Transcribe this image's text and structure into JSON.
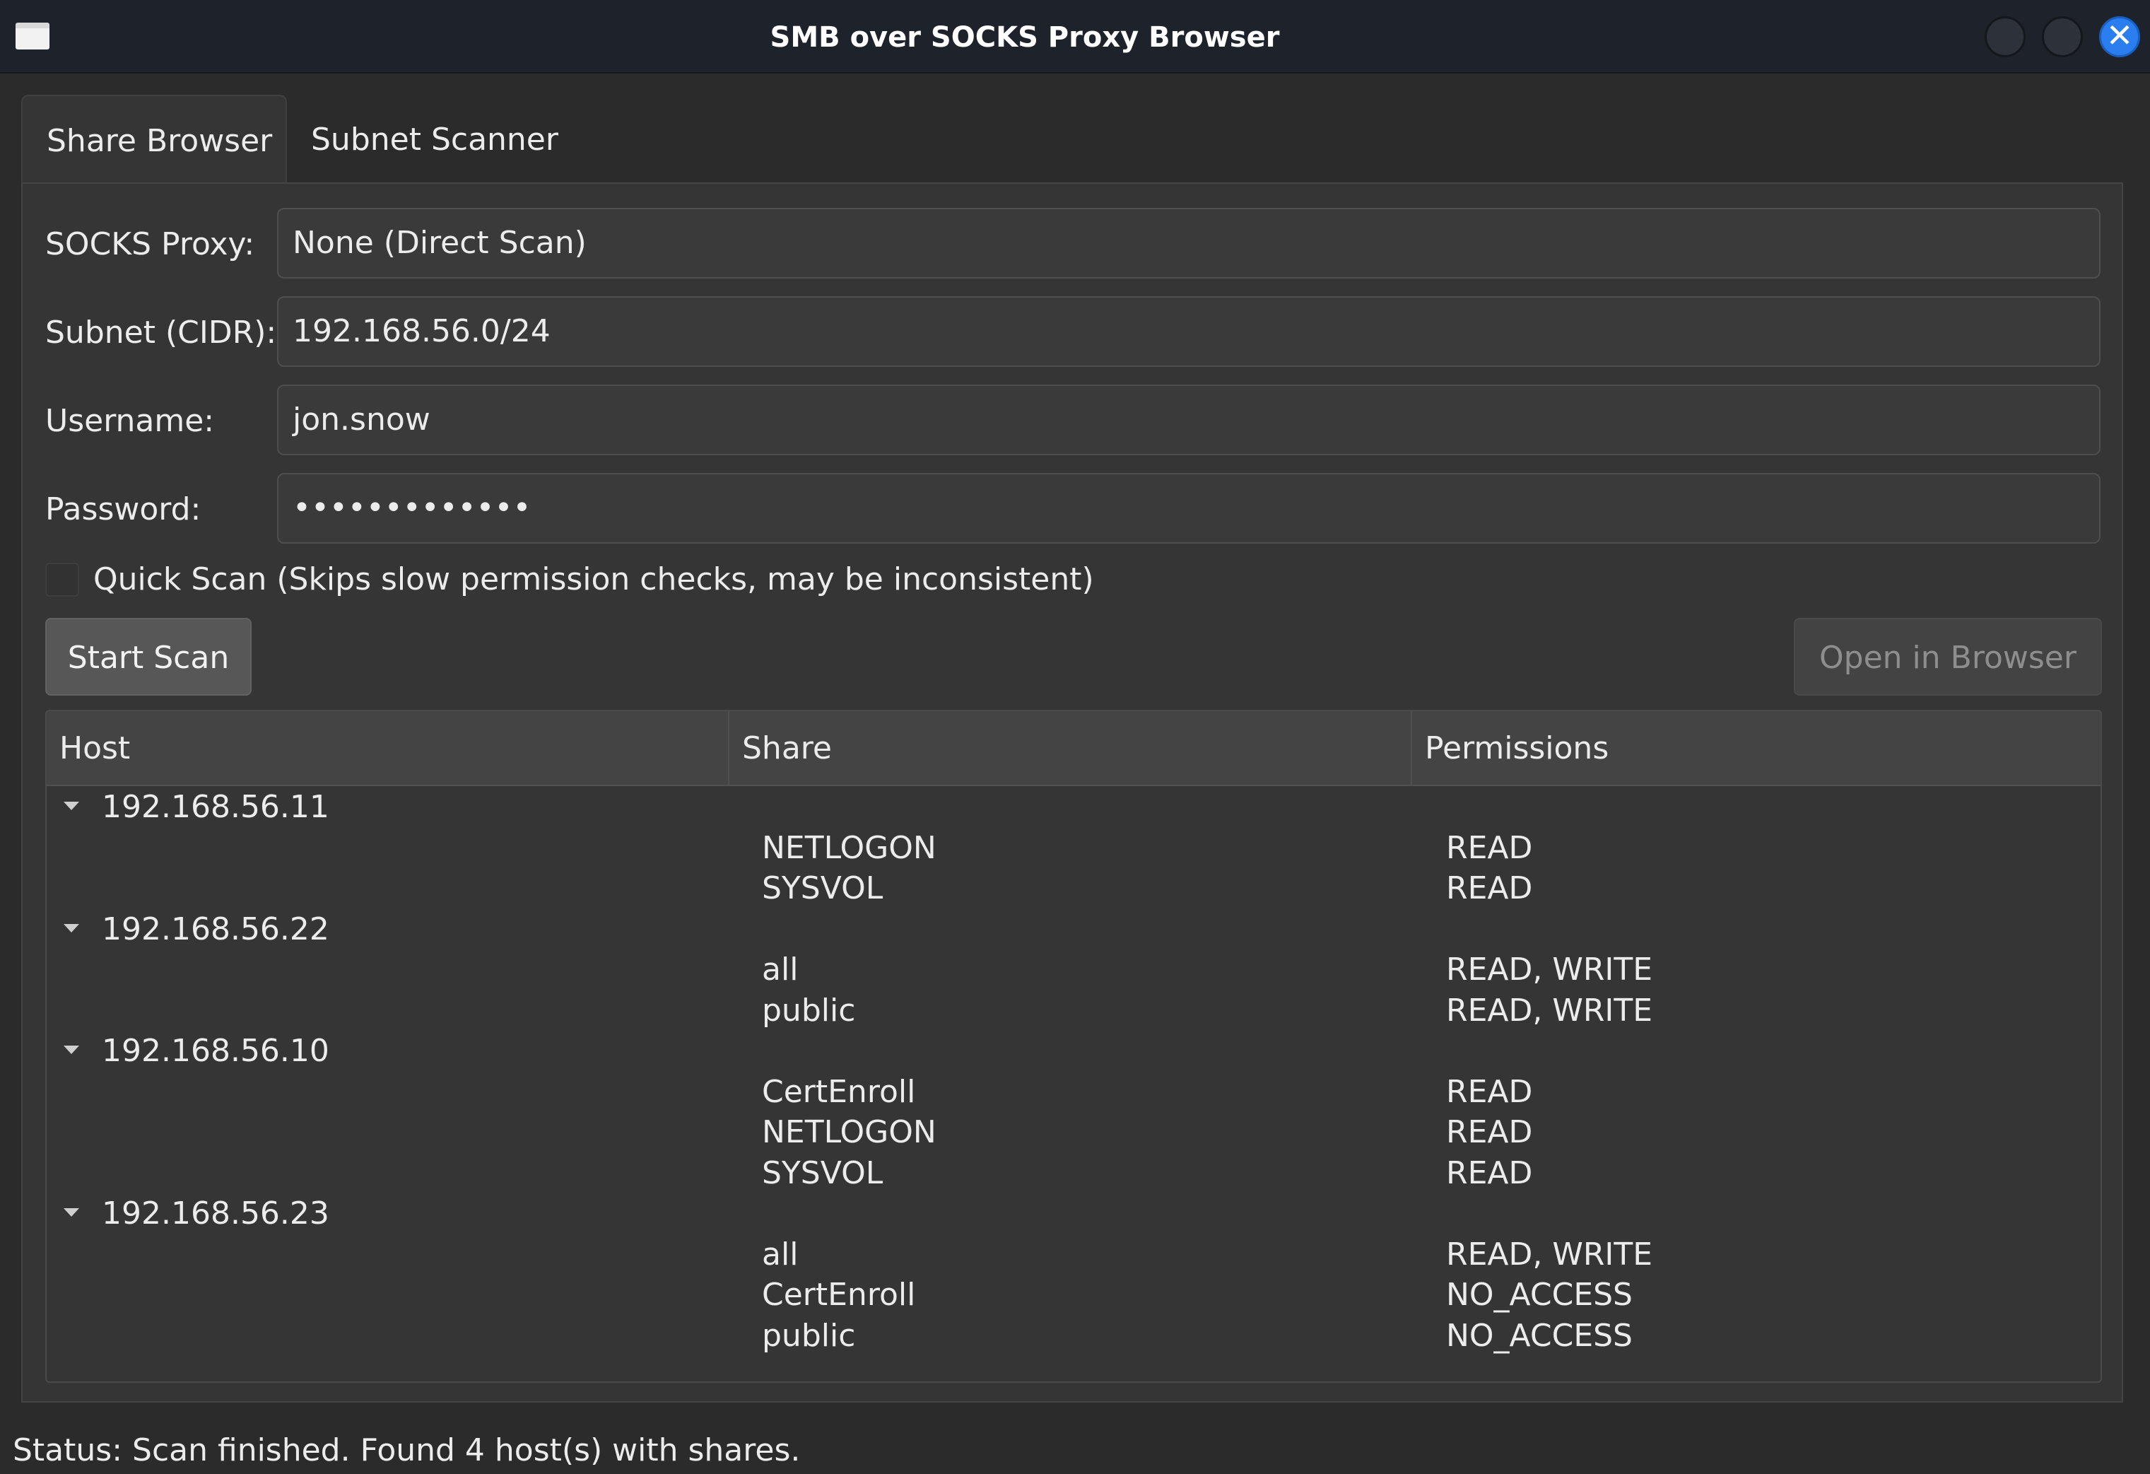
{
  "window": {
    "title": "SMB over SOCKS Proxy Browser",
    "close_glyph": "✕"
  },
  "tabs": [
    {
      "label": "Share Browser",
      "active": true
    },
    {
      "label": "Subnet Scanner",
      "active": false
    }
  ],
  "form": {
    "proxy_label": "SOCKS Proxy:",
    "proxy_value": "None (Direct Scan)",
    "subnet_label": "Subnet (CIDR):",
    "subnet_value": "192.168.56.0/24",
    "username_label": "Username:",
    "username_value": "jon.snow",
    "password_label": "Password:",
    "password_value": "•••••••••••••",
    "quick_scan_label": "Quick Scan (Skips slow permission checks, may be inconsistent)",
    "quick_scan_checked": false
  },
  "actions": {
    "start_scan_label": "Start Scan",
    "open_browser_label": "Open in Browser",
    "open_browser_enabled": false
  },
  "results": {
    "columns": [
      "Host",
      "Share",
      "Permissions"
    ],
    "hosts": [
      {
        "host": "192.168.56.11",
        "expanded": true,
        "shares": [
          {
            "share": "NETLOGON",
            "permissions": "READ"
          },
          {
            "share": "SYSVOL",
            "permissions": "READ"
          }
        ]
      },
      {
        "host": "192.168.56.22",
        "expanded": true,
        "shares": [
          {
            "share": "all",
            "permissions": "READ, WRITE"
          },
          {
            "share": "public",
            "permissions": "READ, WRITE"
          }
        ]
      },
      {
        "host": "192.168.56.10",
        "expanded": true,
        "shares": [
          {
            "share": "CertEnroll",
            "permissions": "READ"
          },
          {
            "share": "NETLOGON",
            "permissions": "READ"
          },
          {
            "share": "SYSVOL",
            "permissions": "READ"
          }
        ]
      },
      {
        "host": "192.168.56.23",
        "expanded": true,
        "shares": [
          {
            "share": "all",
            "permissions": "READ, WRITE"
          },
          {
            "share": "CertEnroll",
            "permissions": "NO_ACCESS"
          },
          {
            "share": "public",
            "permissions": "NO_ACCESS"
          }
        ]
      }
    ]
  },
  "status": {
    "text": "Status: Scan finished. Found 4 host(s) with shares."
  }
}
